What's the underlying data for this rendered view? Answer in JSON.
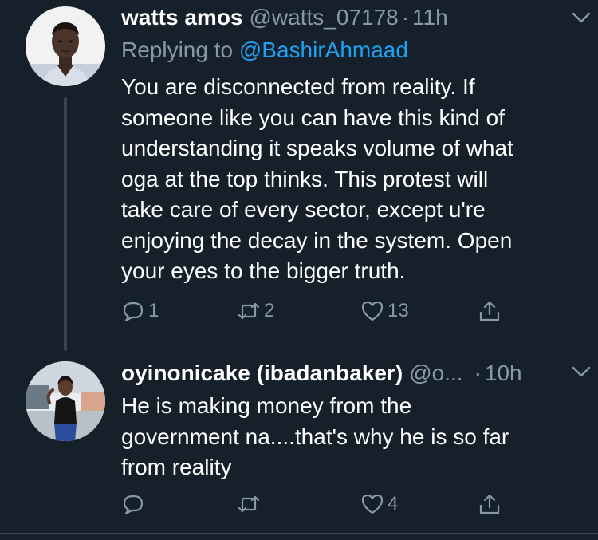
{
  "tweets": [
    {
      "display_name": "watts amos",
      "handle": "@watts_07178",
      "separator": "·",
      "time": "11h",
      "replying_prefix": "Replying to ",
      "replying_to": "@BashirAhmaad",
      "body": "You are disconnected from reality. If\nsomeone like you can have this kind of\nunderstanding it speaks volume of what\noga at the top thinks. This protest will\ntake care of every sector, except u're\nenjoying the decay in the system. Open\nyour eyes to the bigger truth.",
      "reply_count": "1",
      "retweet_count": "2",
      "like_count": "13"
    },
    {
      "display_name": "oyinonicake (ibadanbaker)",
      "handle": "@o...",
      "separator": "·",
      "time": "10h",
      "body": "He is making money from the\ngovernment na....that's why he is so far\nfrom reality",
      "like_count": "4"
    }
  ],
  "icons": {
    "reply": "reply-icon",
    "retweet": "retweet-icon",
    "like": "heart-icon",
    "share": "share-icon",
    "more": "chevron-down-icon"
  },
  "colors": {
    "background": "#15202b",
    "secondary_text": "#8899a6",
    "link": "#1da1f2",
    "divider": "#38444d"
  }
}
